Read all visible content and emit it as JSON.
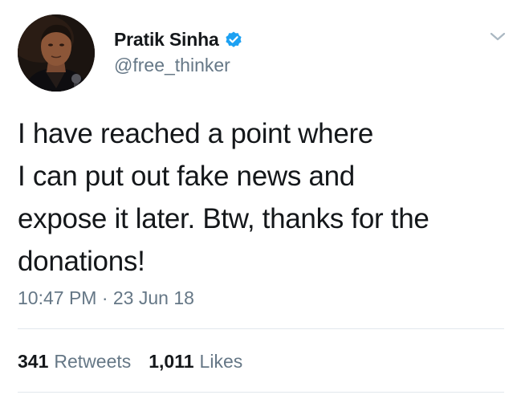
{
  "author": {
    "name": "Pratik Sinha",
    "handle": "@free_thinker",
    "verified": true
  },
  "tweet": {
    "text": "I have reached a point where\nI can put out fake news and\nexpose it later. Btw, thanks for the\ndonations!",
    "timestamp": "10:47 PM · 23 Jun 18"
  },
  "stats": {
    "retweets_count": "341",
    "retweets_label": "Retweets",
    "likes_count": "1,011",
    "likes_label": "Likes"
  },
  "icons": {
    "verified": "verified-badge-icon",
    "menu": "chevron-down-icon"
  },
  "colors": {
    "verified_blue": "#1da1f2",
    "secondary_text": "#657786",
    "primary_text": "#14171a",
    "divider": "#e1e8ed"
  }
}
